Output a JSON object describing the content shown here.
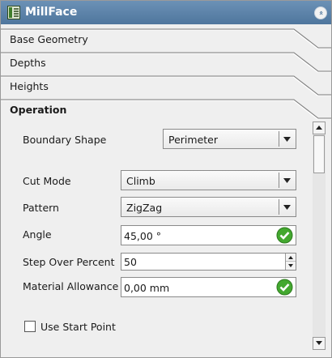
{
  "window": {
    "title": "MillFace",
    "collapse_glyph": "«"
  },
  "sections": [
    {
      "label": "Base Geometry"
    },
    {
      "label": "Depths"
    },
    {
      "label": "Heights"
    },
    {
      "label": "Operation"
    }
  ],
  "operation": {
    "boundary_shape": {
      "label": "Boundary Shape",
      "value": "Perimeter"
    },
    "cut_mode": {
      "label": "Cut Mode",
      "value": "Climb"
    },
    "pattern": {
      "label": "Pattern",
      "value": "ZigZag"
    },
    "angle": {
      "label": "Angle",
      "value": "45,00 °"
    },
    "step_over": {
      "label": "Step Over Percent",
      "value": "50"
    },
    "material_allowance": {
      "label": "Material Allowance",
      "value": "0,00 mm"
    },
    "use_start_point": {
      "label": "Use Start Point",
      "checked": false
    }
  },
  "icons": {
    "window": "millface-icon",
    "collapse": "collapse-icon",
    "valid": "check-icon",
    "dropdown": "chevron-down-icon"
  },
  "colors": {
    "titlebar": "#5b82a8",
    "valid": "#43a82f"
  }
}
